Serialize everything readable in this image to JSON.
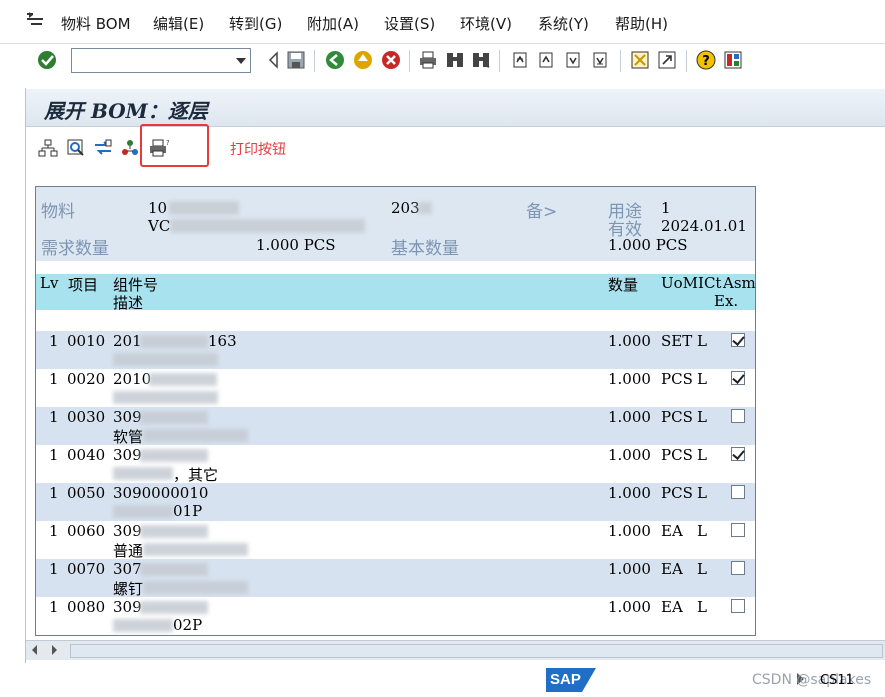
{
  "menu": {
    "items": [
      "物料 BOM",
      "编辑(E)",
      "转到(G)",
      "附加(A)",
      "设置(S)",
      "环境(V)",
      "系统(Y)",
      "帮助(H)"
    ]
  },
  "toolbar": {
    "command_field_value": ""
  },
  "screen": {
    "title": "展开 BOM：逐层"
  },
  "annotation": {
    "text": "打印按钮"
  },
  "header": {
    "material_label": "物料",
    "material_value": "10",
    "material_line2": "VC",
    "plant_value": "203",
    "alt_label": "备>",
    "usage_label": "用途",
    "usage_value": "1",
    "valid_label": "有效",
    "valid_value": "2024.01.01",
    "req_qty_label": "需求数量",
    "req_qty_value": "1.000 PCS",
    "base_qty_label": "基本数量",
    "base_qty_value": "1.000 PCS"
  },
  "columns": {
    "lv": "Lv",
    "item": "项目",
    "component": "组件号",
    "desc": "描述",
    "qty": "数量",
    "uom": "UoMICt",
    "asm": "Asm",
    "ex": "Ex."
  },
  "rows": [
    {
      "lv": "1",
      "item": "0010",
      "comp": "201",
      "comp_tail": "163",
      "desc": "",
      "desc_tail": "",
      "qty": "1.000",
      "uom": "SET",
      "cat": "L",
      "asm": true
    },
    {
      "lv": "1",
      "item": "0020",
      "comp": "2010",
      "comp_tail": "",
      "desc": "",
      "desc_tail": "",
      "qty": "1.000",
      "uom": "PCS",
      "cat": "L",
      "asm": true
    },
    {
      "lv": "1",
      "item": "0030",
      "comp": "309",
      "comp_tail": "",
      "desc": "软管",
      "desc_tail": "",
      "qty": "1.000",
      "uom": "PCS",
      "cat": "L",
      "asm": false
    },
    {
      "lv": "1",
      "item": "0040",
      "comp": "309",
      "comp_tail": "",
      "desc": "",
      "desc_tail": "，其它",
      "qty": "1.000",
      "uom": "PCS",
      "cat": "L",
      "asm": true
    },
    {
      "lv": "1",
      "item": "0050",
      "comp": "3090000010",
      "comp_tail": "",
      "desc": "",
      "desc_tail": "01P",
      "qty": "1.000",
      "uom": "PCS",
      "cat": "L",
      "asm": false
    },
    {
      "lv": "1",
      "item": "0060",
      "comp": "309",
      "comp_tail": "",
      "desc": "普通",
      "desc_tail": "",
      "qty": "1.000",
      "uom": "EA",
      "cat": "L",
      "asm": false
    },
    {
      "lv": "1",
      "item": "0070",
      "comp": "307",
      "comp_tail": "",
      "desc": "螺钉",
      "desc_tail": "",
      "qty": "1.000",
      "uom": "EA",
      "cat": "L",
      "asm": false
    },
    {
      "lv": "1",
      "item": "0080",
      "comp": "309",
      "comp_tail": "",
      "desc": "",
      "desc_tail": "02P",
      "qty": "1.000",
      "uom": "EA",
      "cat": "L",
      "asm": false
    }
  ],
  "status": {
    "logo": "SAP",
    "tcode": "CS11",
    "watermark": "CSDN @saplakes"
  }
}
